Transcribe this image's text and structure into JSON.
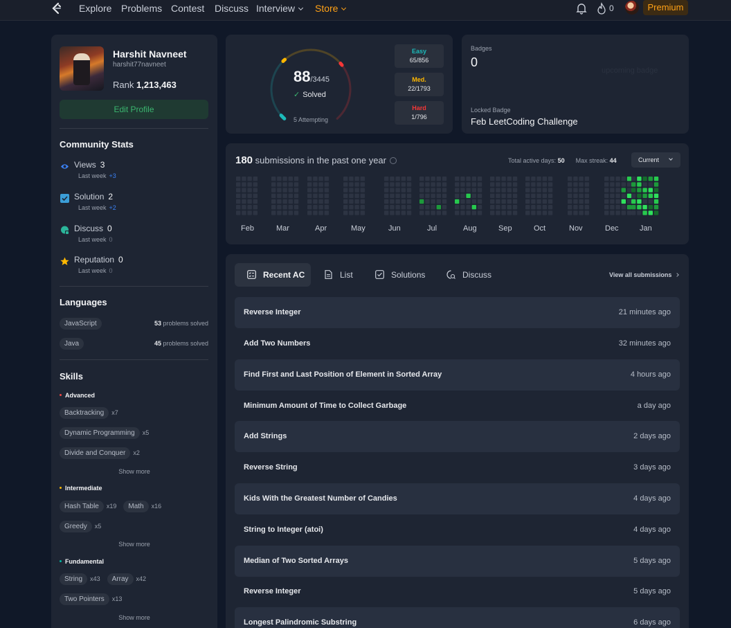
{
  "nav": {
    "items": [
      "Explore",
      "Problems",
      "Contest",
      "Discuss",
      "Interview"
    ],
    "store": "Store",
    "streak_count": "0",
    "premium": "Premium",
    "colors": {
      "accent": "#ffa116"
    }
  },
  "profile": {
    "name": "Harshit Navneet",
    "handle": "harshit77navneet",
    "rank_label": "Rank",
    "rank_value": "1,213,463",
    "edit_button": "Edit Profile"
  },
  "community": {
    "title": "Community Stats",
    "stats": [
      {
        "icon": "eye-icon",
        "label": "Views",
        "value": "3",
        "sub": "Last week",
        "delta": "+3",
        "delta_color": "#3b82f6"
      },
      {
        "icon": "checkbox-icon",
        "label": "Solution",
        "value": "2",
        "sub": "Last week",
        "delta": "+2",
        "delta_color": "#3b82f6"
      },
      {
        "icon": "chat-icon",
        "label": "Discuss",
        "value": "0",
        "sub": "Last week",
        "delta": "0",
        "delta_color": "#6b7280"
      },
      {
        "icon": "star-icon",
        "label": "Reputation",
        "value": "0",
        "sub": "Last week",
        "delta": "0",
        "delta_color": "#6b7280"
      }
    ]
  },
  "languages": {
    "title": "Languages",
    "items": [
      {
        "name": "JavaScript",
        "count": "53",
        "suffix": "problems solved"
      },
      {
        "name": "Java",
        "count": "45",
        "suffix": "problems solved"
      }
    ]
  },
  "skills": {
    "title": "Skills",
    "show_more": "Show more",
    "levels": [
      {
        "name": "Advanced",
        "color": "#ef4743",
        "tags": [
          [
            "Backtracking",
            "x7"
          ],
          [
            "Dynamic Programming",
            "x5"
          ],
          [
            "Divide and Conquer",
            "x2"
          ]
        ]
      },
      {
        "name": "Intermediate",
        "color": "#ffb800",
        "tags": [
          [
            "Hash Table",
            "x19"
          ],
          [
            "Math",
            "x16"
          ],
          [
            "Greedy",
            "x5"
          ]
        ]
      },
      {
        "name": "Fundamental",
        "color": "#00b8a3",
        "tags": [
          [
            "String",
            "x43"
          ],
          [
            "Array",
            "x42"
          ],
          [
            "Two Pointers",
            "x13"
          ]
        ]
      }
    ]
  },
  "solved": {
    "count": "88",
    "total": "/3445",
    "label": "Solved",
    "attempting": "5 Attempting",
    "progress": {
      "easy": 0.0759,
      "medium": 0.0123,
      "hard": 0.0013
    },
    "difficulties": [
      {
        "name": "Easy",
        "value": "65/856",
        "color": "#1cbaba"
      },
      {
        "name": "Med.",
        "value": "22/1793",
        "color": "#ffb700"
      },
      {
        "name": "Hard",
        "value": "1/796",
        "color": "#f63737"
      }
    ]
  },
  "badges": {
    "label": "Badges",
    "count": "0",
    "upcoming": "upcoming badge",
    "locked_label": "Locked Badge",
    "locked_value": "Feb LeetCoding Challenge"
  },
  "submissions": {
    "count": "180",
    "text": "submissions in the past one year",
    "active_label": "Total active days:",
    "active_value": "50",
    "streak_label": "Max streak:",
    "streak_value": "44",
    "select": "Current",
    "months": [
      "Feb",
      "Mar",
      "Apr",
      "May",
      "Jun",
      "Jul",
      "Aug",
      "Sep",
      "Oct",
      "Nov",
      "Dec",
      "Jan"
    ]
  },
  "recent": {
    "tabs": [
      {
        "icon": "checklist-icon",
        "label": "Recent AC"
      },
      {
        "icon": "document-icon",
        "label": "List"
      },
      {
        "icon": "checkbox-icon",
        "label": "Solutions"
      },
      {
        "icon": "discuss-icon",
        "label": "Discuss"
      }
    ],
    "view_all": "View all submissions",
    "rows": [
      {
        "title": "Reverse Integer",
        "time": "21 minutes ago"
      },
      {
        "title": "Add Two Numbers",
        "time": "32 minutes ago"
      },
      {
        "title": "Find First and Last Position of Element in Sorted Array",
        "time": "4 hours ago"
      },
      {
        "title": "Minimum Amount of Time to Collect Garbage",
        "time": "a day ago"
      },
      {
        "title": "Add Strings",
        "time": "2 days ago"
      },
      {
        "title": "Reverse String",
        "time": "3 days ago"
      },
      {
        "title": "Kids With the Greatest Number of Candies",
        "time": "4 days ago"
      },
      {
        "title": "String to Integer (atoi)",
        "time": "4 days ago"
      },
      {
        "title": "Median of Two Sorted Arrays",
        "time": "5 days ago"
      },
      {
        "title": "Reverse Integer",
        "time": "5 days ago"
      },
      {
        "title": "Longest Palindromic Substring",
        "time": "6 days ago"
      }
    ]
  }
}
